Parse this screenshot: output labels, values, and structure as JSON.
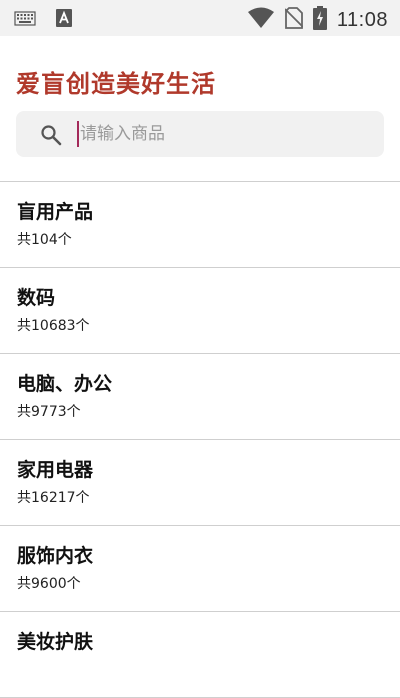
{
  "status_bar": {
    "time": "11:08",
    "icons": [
      "keyboard-icon",
      "a-notification-icon",
      "wifi-icon",
      "no-sim-icon",
      "battery-charging-icon"
    ]
  },
  "header": {
    "title": "爱盲创造美好生活"
  },
  "search": {
    "placeholder": "请输入商品",
    "value": ""
  },
  "categories": [
    {
      "name": "盲用产品",
      "count": "共104个"
    },
    {
      "name": "数码",
      "count": "共10683个"
    },
    {
      "name": "电脑、办公",
      "count": "共9773个"
    },
    {
      "name": "家用电器",
      "count": "共16217个"
    },
    {
      "name": "服饰内衣",
      "count": "共9600个"
    },
    {
      "name": "美妆护肤",
      "count": ""
    }
  ],
  "colors": {
    "title": "#b0392b",
    "status_bar_bg": "#f2f2f2",
    "search_bg": "#f1f1f1",
    "divider": "#cfcfcf"
  }
}
